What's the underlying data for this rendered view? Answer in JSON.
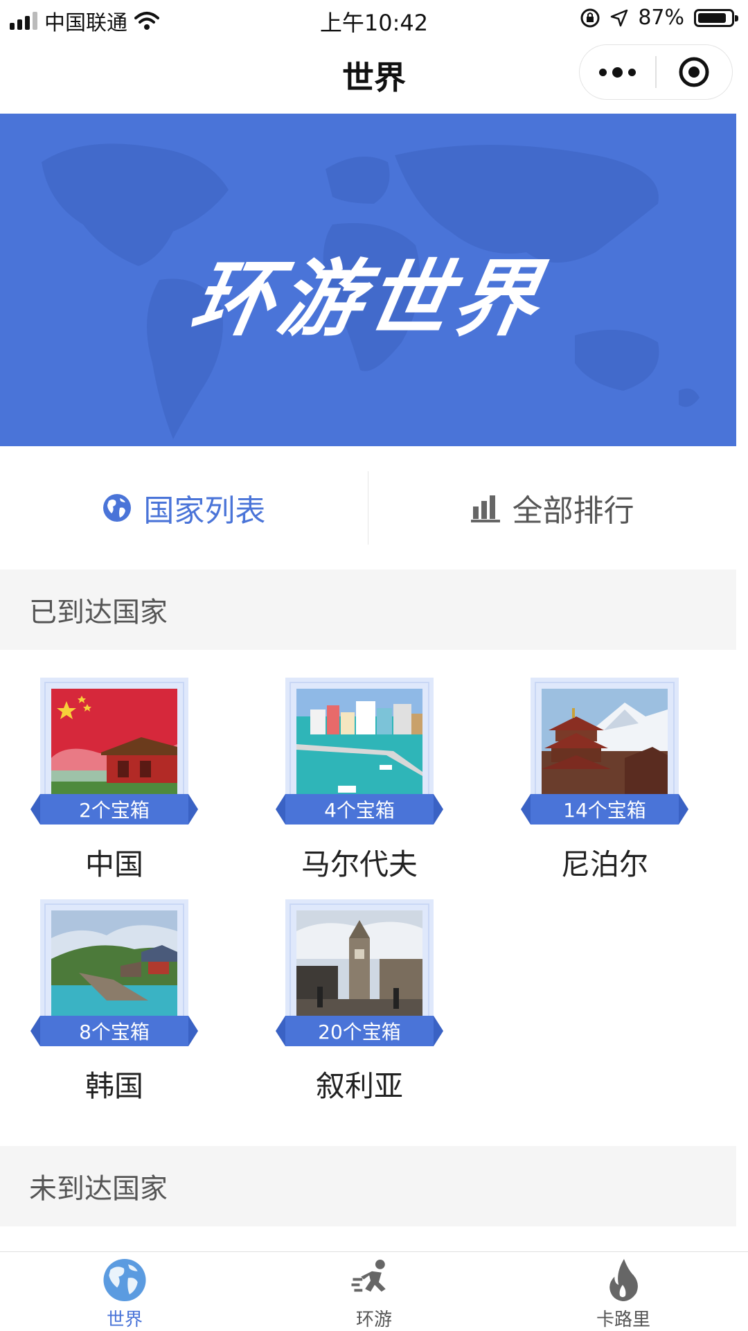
{
  "status_bar": {
    "carrier": "中国联通",
    "time": "上午10:42",
    "battery_percent": "87%",
    "battery_level": 0.87,
    "icons": [
      "signal-icon",
      "wifi-icon",
      "orientation-lock-icon",
      "location-arrow-icon",
      "battery-icon"
    ]
  },
  "nav": {
    "title": "世界",
    "more_icon": "more-dots-icon",
    "close_icon": "target-circle-icon"
  },
  "banner": {
    "title": "环游世界",
    "background_color": "#4a74d8"
  },
  "tabs": [
    {
      "label": "国家列表",
      "icon": "globe-icon",
      "active": true
    },
    {
      "label": "全部排行",
      "icon": "bar-chart-icon",
      "active": false
    }
  ],
  "visited_section": {
    "header": "已到达国家",
    "countries": [
      {
        "name": "中国",
        "treasure": "2个宝箱",
        "photo": "china-flag-tiananmen"
      },
      {
        "name": "马尔代夫",
        "treasure": "4个宝箱",
        "photo": "maldives-harbor"
      },
      {
        "name": "尼泊尔",
        "treasure": "14个宝箱",
        "photo": "nepal-pagoda-mountain"
      },
      {
        "name": "韩国",
        "treasure": "8个宝箱",
        "photo": "korea-coast-temple"
      },
      {
        "name": "叙利亚",
        "treasure": "20个宝箱",
        "photo": "syria-clock-tower"
      }
    ]
  },
  "unvisited_section": {
    "header": "未到达国家"
  },
  "tabbar": {
    "items": [
      {
        "label": "世界",
        "icon": "globe-icon",
        "active": true
      },
      {
        "label": "环游",
        "icon": "runner-icon",
        "active": false
      },
      {
        "label": "卡路里",
        "icon": "flame-icon",
        "active": false
      }
    ]
  },
  "colors": {
    "accent": "#4a74d8",
    "section_bg": "#f5f5f5"
  }
}
